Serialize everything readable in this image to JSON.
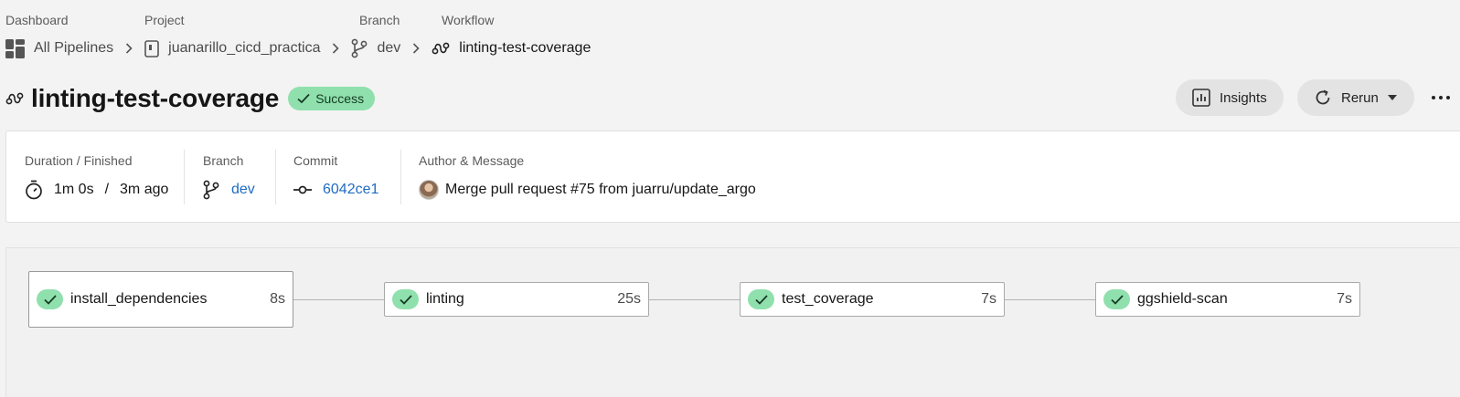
{
  "breadcrumb": {
    "labels": [
      "Dashboard",
      "Project",
      "Branch",
      "Workflow"
    ],
    "items": [
      {
        "text": "All Pipelines",
        "icon": "dashboard-grid-icon"
      },
      {
        "text": "juanarillo_cicd_practica",
        "icon": "repo-icon"
      },
      {
        "text": "dev",
        "icon": "branch-icon"
      },
      {
        "text": "linting-test-coverage",
        "icon": "workflow-icon"
      }
    ]
  },
  "header": {
    "title": "linting-test-coverage",
    "status": "Success",
    "status_color": "#8fe0ad",
    "insights_label": "Insights",
    "rerun_label": "Rerun",
    "more_icon": "more-horizontal-icon"
  },
  "summary": {
    "duration_label": "Duration / Finished",
    "duration": "1m 0s",
    "separator": "/",
    "finished": "3m ago",
    "branch_label": "Branch",
    "branch": "dev",
    "commit_label": "Commit",
    "commit": "6042ce1",
    "author_label": "Author & Message",
    "message": "Merge pull request #75 from juarru/update_argo"
  },
  "jobs": [
    {
      "name": "install_dependencies",
      "duration": "8s"
    },
    {
      "name": "linting",
      "duration": "25s"
    },
    {
      "name": "test_coverage",
      "duration": "7s"
    },
    {
      "name": "ggshield-scan",
      "duration": "7s"
    }
  ],
  "colors": {
    "link": "#1e6bc4",
    "success": "#8fe0ad"
  }
}
